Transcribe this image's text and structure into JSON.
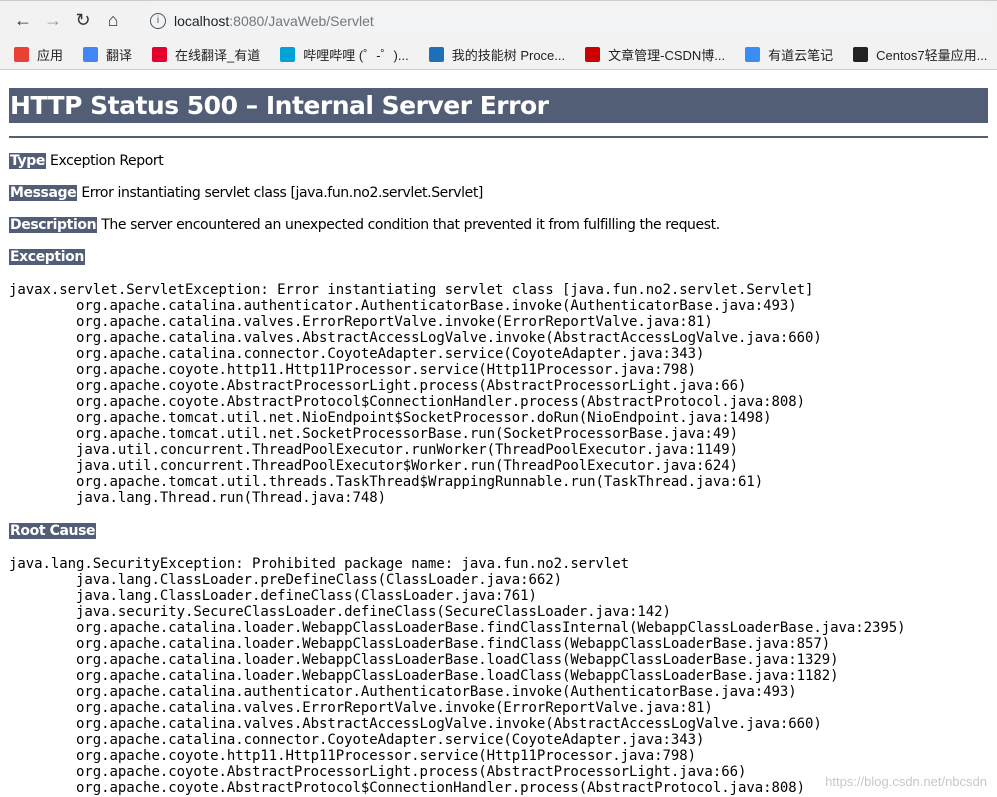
{
  "browser": {
    "url_host": "localhost",
    "url_path": ":8080/JavaWeb/Servlet",
    "bookmarks": [
      {
        "label": "应用",
        "icon": "apps-grid-icon",
        "color": "#e94235"
      },
      {
        "label": "翻译",
        "icon": "google-translate-icon",
        "color": "#4285f4"
      },
      {
        "label": "在线翻译_有道",
        "icon": "youdao-icon",
        "color": "#e4002b"
      },
      {
        "label": "哔哩哔哩 (゜-゜)...",
        "icon": "bilibili-icon",
        "color": "#00a1d6"
      },
      {
        "label": "我的技能树 Proce...",
        "icon": "processon-icon",
        "color": "#1e6fb8"
      },
      {
        "label": "文章管理-CSDN博...",
        "icon": "csdn-icon",
        "color": "#c00"
      },
      {
        "label": "有道云笔记",
        "icon": "youdao-note-icon",
        "color": "#3b8cf5"
      },
      {
        "label": "Centos7轻量应用...",
        "icon": "globe-icon",
        "color": "#222"
      }
    ]
  },
  "page": {
    "title": "HTTP Status 500 – Internal Server Error",
    "type_label": "Type",
    "type_value": "Exception Report",
    "message_label": "Message",
    "message_value": "Error instantiating servlet class [java.fun.no2.servlet.Servlet]",
    "description_label": "Description",
    "description_value": "The server encountered an unexpected condition that prevented it from fulfilling the request.",
    "exception_label": "Exception",
    "exception_trace": "javax.servlet.ServletException: Error instantiating servlet class [java.fun.no2.servlet.Servlet]\n\torg.apache.catalina.authenticator.AuthenticatorBase.invoke(AuthenticatorBase.java:493)\n\torg.apache.catalina.valves.ErrorReportValve.invoke(ErrorReportValve.java:81)\n\torg.apache.catalina.valves.AbstractAccessLogValve.invoke(AbstractAccessLogValve.java:660)\n\torg.apache.catalina.connector.CoyoteAdapter.service(CoyoteAdapter.java:343)\n\torg.apache.coyote.http11.Http11Processor.service(Http11Processor.java:798)\n\torg.apache.coyote.AbstractProcessorLight.process(AbstractProcessorLight.java:66)\n\torg.apache.coyote.AbstractProtocol$ConnectionHandler.process(AbstractProtocol.java:808)\n\torg.apache.tomcat.util.net.NioEndpoint$SocketProcessor.doRun(NioEndpoint.java:1498)\n\torg.apache.tomcat.util.net.SocketProcessorBase.run(SocketProcessorBase.java:49)\n\tjava.util.concurrent.ThreadPoolExecutor.runWorker(ThreadPoolExecutor.java:1149)\n\tjava.util.concurrent.ThreadPoolExecutor$Worker.run(ThreadPoolExecutor.java:624)\n\torg.apache.tomcat.util.threads.TaskThread$WrappingRunnable.run(TaskThread.java:61)\n\tjava.lang.Thread.run(Thread.java:748)",
    "root_cause_label": "Root Cause",
    "root_cause_trace": "java.lang.SecurityException: Prohibited package name: java.fun.no2.servlet\n\tjava.lang.ClassLoader.preDefineClass(ClassLoader.java:662)\n\tjava.lang.ClassLoader.defineClass(ClassLoader.java:761)\n\tjava.security.SecureClassLoader.defineClass(SecureClassLoader.java:142)\n\torg.apache.catalina.loader.WebappClassLoaderBase.findClassInternal(WebappClassLoaderBase.java:2395)\n\torg.apache.catalina.loader.WebappClassLoaderBase.findClass(WebappClassLoaderBase.java:857)\n\torg.apache.catalina.loader.WebappClassLoaderBase.loadClass(WebappClassLoaderBase.java:1329)\n\torg.apache.catalina.loader.WebappClassLoaderBase.loadClass(WebappClassLoaderBase.java:1182)\n\torg.apache.catalina.authenticator.AuthenticatorBase.invoke(AuthenticatorBase.java:493)\n\torg.apache.catalina.valves.ErrorReportValve.invoke(ErrorReportValve.java:81)\n\torg.apache.catalina.valves.AbstractAccessLogValve.invoke(AbstractAccessLogValve.java:660)\n\torg.apache.catalina.connector.CoyoteAdapter.service(CoyoteAdapter.java:343)\n\torg.apache.coyote.http11.Http11Processor.service(Http11Processor.java:798)\n\torg.apache.coyote.AbstractProcessorLight.process(AbstractProcessorLight.java:66)\n\torg.apache.coyote.AbstractProtocol$ConnectionHandler.process(AbstractProtocol.java:808)"
  },
  "watermark": "https://blog.csdn.net/nbcsdn"
}
